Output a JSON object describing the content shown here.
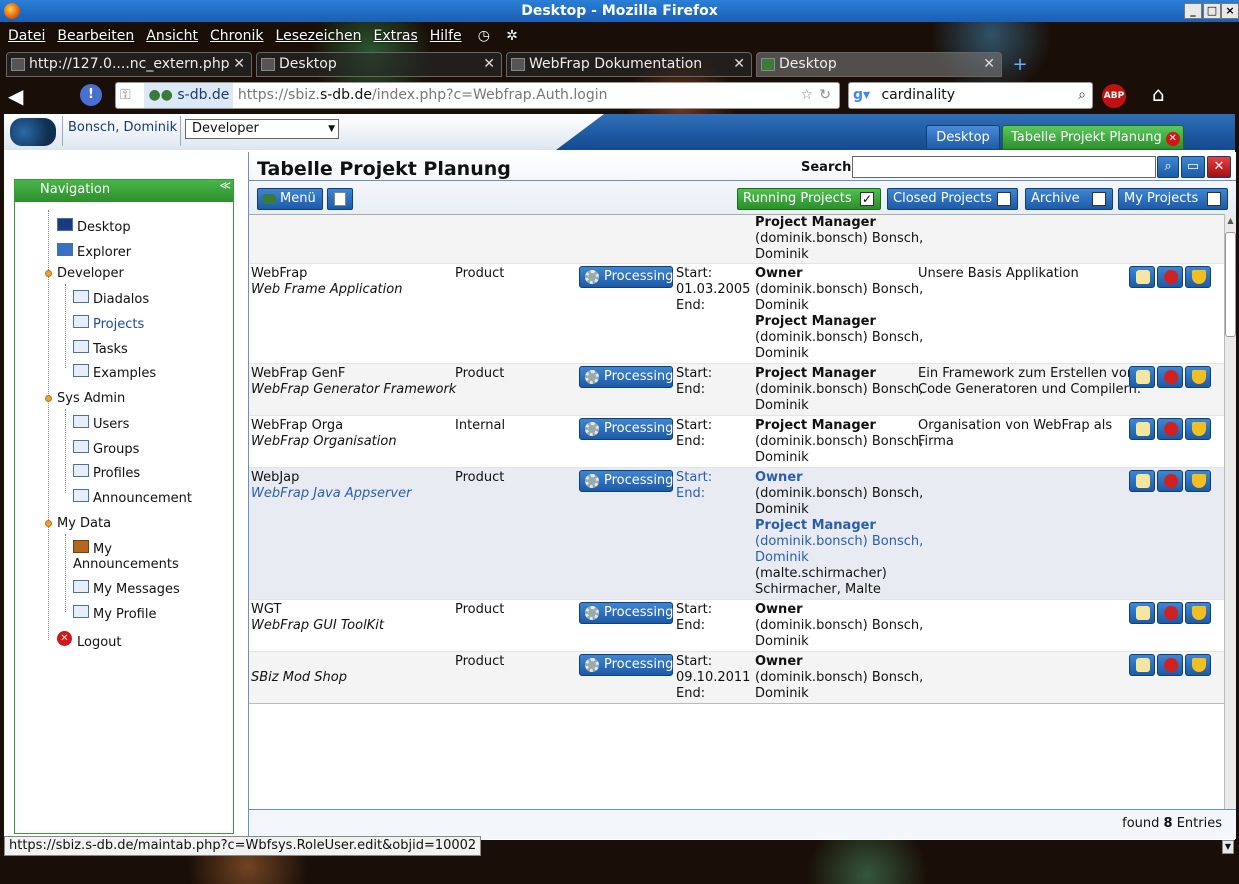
{
  "window": {
    "title": "Desktop - Mozilla Firefox"
  },
  "menu": [
    "Datei",
    "Bearbeiten",
    "Ansicht",
    "Chronik",
    "Lesezeichen",
    "Extras",
    "Hilfe"
  ],
  "tabs": [
    {
      "label": "http://127.0....nc_extern.php"
    },
    {
      "label": "Desktop"
    },
    {
      "label": "WebFrap Dokumentation"
    },
    {
      "label": "Desktop"
    }
  ],
  "address": {
    "domain": "s-db.de",
    "url_prefix": "https://sbiz.",
    "url_host": "s-db.de",
    "url_path": "/index.php?c=Webfrap.Auth.login"
  },
  "search_engine": {
    "value": "cardinality"
  },
  "app": {
    "user": "Bonsch, Dominik",
    "role": "Developer",
    "tabs": [
      {
        "label": "Desktop"
      },
      {
        "label": "Tabelle Projekt Planung"
      }
    ]
  },
  "nav": {
    "title": "Navigation",
    "items": {
      "desktop": "Desktop",
      "explorer": "Explorer",
      "developer": "Developer",
      "diadalos": "Diadalos",
      "projects": "Projects",
      "tasks": "Tasks",
      "examples": "Examples",
      "sysadmin": "Sys Admin",
      "users": "Users",
      "groups": "Groups",
      "profiles": "Profiles",
      "announcement": "Announcement",
      "mydata": "My Data",
      "my_announcements_1": "My",
      "my_announcements_2": "Announcements",
      "my_messages": "My Messages",
      "my_profile": "My Profile",
      "logout": "Logout"
    }
  },
  "main": {
    "title": "Tabelle Projekt Planung",
    "search_label": "Search",
    "menu_button": "Menü",
    "filters": {
      "running": "Running Projects",
      "closed": "Closed Projects",
      "archive": "Archive",
      "mine": "My Projects"
    },
    "footer_found": "found",
    "footer_count": "8",
    "footer_entries": "Entries"
  },
  "rows": [
    {
      "pm_label": "Project Manager",
      "pm_login": "(dominik.bonsch) Bonsch,",
      "pm_first": "Dominik"
    },
    {
      "name": "WebFrap",
      "desc": "Web Frame Application",
      "type": "Product",
      "status": "Processing",
      "start_label": "Start:",
      "start": "01.03.2005",
      "end_label": "End:",
      "owner_label": "Owner",
      "owner_login": "(dominik.bonsch) Bonsch,",
      "owner_first": "Dominik",
      "pm_label": "Project Manager",
      "pm_login": "(dominik.bonsch) Bonsch,",
      "pm_first": "Dominik",
      "note": "Unsere Basis Applikation"
    },
    {
      "name": "WebFrap GenF",
      "desc": "WebFrap Generator Framework",
      "type": "Product",
      "status": "Processing",
      "start_label": "Start:",
      "end_label": "End:",
      "pm_label": "Project Manager",
      "pm_login": "(dominik.bonsch) Bonsch,",
      "pm_first": "Dominik",
      "note1": "Ein Framework zum Erstellen von",
      "note2": "Code Generatoren und Compilern."
    },
    {
      "name": "WebFrap Orga",
      "desc": "WebFrap Organisation",
      "type": "Internal",
      "status": "Processing",
      "start_label": "Start:",
      "end_label": "End:",
      "pm_label": "Project Manager",
      "pm_login": "(dominik.bonsch) Bonsch,",
      "pm_first": "Dominik",
      "note1": "Organisation von WebFrap als",
      "note2": "Firma"
    },
    {
      "name": "WebJap",
      "desc": "WebFrap Java Appserver",
      "type": "Product",
      "status": "Processing",
      "start_label": "Start:",
      "end_label": "End:",
      "owner_label": "Owner",
      "owner_login": "(dominik.bonsch) Bonsch,",
      "owner_first": "Dominik",
      "pm_label": "Project Manager",
      "pm_login": "(dominik.bonsch) Bonsch,",
      "pm_first": "Dominik",
      "pm2_login": "(malte.schirmacher)",
      "pm2_name": "Schirmacher, Malte"
    },
    {
      "name": "WGT",
      "desc": "WebFrap GUI ToolKit",
      "type": "Product",
      "status": "Processing",
      "start_label": "Start:",
      "end_label": "End:",
      "owner_label": "Owner",
      "owner_login": "(dominik.bonsch) Bonsch,",
      "owner_first": "Dominik"
    },
    {
      "desc": "SBiz Mod Shop",
      "type": "Product",
      "status": "Processing",
      "start_label": "Start:",
      "start": "09.10.2011",
      "end_label": "End:",
      "owner_label": "Owner",
      "owner_login": "(dominik.bonsch) Bonsch,",
      "owner_first": "Dominik"
    }
  ],
  "statusbar": {
    "url": "https://sbiz.s-db.de/maintab.php?c=Wbfsys.RoleUser.edit&objid=10002"
  },
  "colors": {
    "accent": "#1d5ba8",
    "nav_green": "#2d8f2d",
    "link_blue": "#2a5db0"
  }
}
